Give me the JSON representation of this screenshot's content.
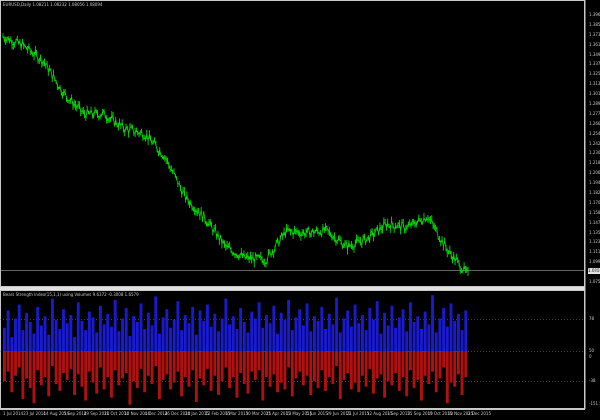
{
  "main_chart": {
    "title": "EURUSD,Daily  1.08211 1.08232 1.08056 1.08094",
    "current_price": "1.08094",
    "y_ticks": [
      "1.39690",
      "1.38500",
      "1.37310",
      "1.36120",
      "1.34930",
      "1.33740",
      "1.32550",
      "1.31360",
      "1.30170",
      "1.28980",
      "1.27790",
      "1.26600",
      "1.25410",
      "1.24220",
      "1.23030",
      "1.21840",
      "1.20650",
      "1.19460",
      "1.18270",
      "1.17080",
      "1.15890",
      "1.14700",
      "1.13510",
      "1.12320",
      "1.11130",
      "1.09940",
      "1.08750",
      "1.07560"
    ]
  },
  "indicator": {
    "title": "Bears Strength Index(15,1,1) using Volumes  9.6372  -0.3008  1.6579",
    "y_ticks": [
      "78",
      "50",
      "0",
      "-38",
      "-151.5"
    ]
  },
  "x_axis": {
    "ticks": [
      "1 Jul 2014",
      "23 Jul 2014",
      "14 Aug 2014",
      "5 Sep 2014",
      "29 Sep 2014",
      "21 Oct 2014",
      "12 Nov 2014",
      "4 Dec 2014",
      "26 Dec 2014",
      "20 Jan 2015",
      "12 Feb 2015",
      "6 Mar 2015",
      "30 Mar 2015",
      "21 Apr 2015",
      "13 May 2015",
      "5 Jun 2015",
      "29 Jun 2015",
      "21 Jul 2015",
      "12 Aug 2015",
      "3 Sep 2015",
      "25 Sep 2015",
      "19 Oct 2015",
      "10 Nov 2015",
      "2 Dec 2015"
    ]
  },
  "chart_data": [
    {
      "type": "line",
      "title": "EURUSD,Daily  1.08211 1.08232 1.08056 1.08094",
      "series": [
        {
          "name": "EURUSD",
          "color": "#00e000",
          "x": [
            "1 Jul 2014",
            "23 Jul 2014",
            "14 Aug 2014",
            "5 Sep 2014",
            "29 Sep 2014",
            "21 Oct 2014",
            "12 Nov 2014",
            "4 Dec 2014",
            "26 Dec 2014",
            "20 Jan 2015",
            "12 Feb 2015",
            "6 Mar 2015",
            "30 Mar 2015",
            "21 Apr 2015",
            "13 May 2015",
            "5 Jun 2015",
            "29 Jun 2015",
            "21 Jul 2015",
            "12 Aug 2015",
            "3 Sep 2015",
            "25 Sep 2015",
            "19 Oct 2015",
            "10 Nov 2015",
            "2 Dec 2015"
          ],
          "values": [
            1.369,
            1.357,
            1.337,
            1.295,
            1.268,
            1.268,
            1.249,
            1.242,
            1.213,
            1.16,
            1.132,
            1.095,
            1.08,
            1.078,
            1.115,
            1.113,
            1.116,
            1.095,
            1.105,
            1.125,
            1.12,
            1.135,
            1.09,
            1.058
          ]
        }
      ],
      "ylim": [
        1.049,
        1.3969
      ],
      "grid": false
    },
    {
      "type": "bar",
      "title": "Bears Strength Index(15,1,1) using Volumes  9.6372  -0.3008  1.6579",
      "series": [
        {
          "name": "positive",
          "color": "#1a1ad0",
          "values": [
            20,
            35,
            12,
            28,
            40,
            18,
            33,
            25,
            15,
            38,
            22,
            30,
            14,
            45,
            27,
            19,
            36,
            24,
            31,
            12,
            42,
            26,
            18,
            34,
            29,
            16,
            39,
            23,
            32,
            21,
            44,
            17,
            28,
            37,
            13,
            30,
            25,
            41,
            19,
            33,
            22,
            47,
            15,
            29,
            36,
            20,
            27,
            43,
            18,
            31,
            24,
            38,
            14,
            35,
            26,
            40,
            21,
            32,
            17,
            28,
            45,
            23,
            30,
            19,
            37,
            25,
            16,
            34,
            28,
            42,
            20,
            31,
            24,
            39,
            15,
            33,
            27,
            44,
            18,
            29,
            36,
            22,
            41,
            17,
            30,
            26,
            38,
            19,
            32,
            23,
            46,
            16,
            28,
            35,
            21,
            40,
            24,
            31,
            18,
            37,
            27,
            43,
            15,
            33,
            22,
            39,
            20,
            29,
            36,
            17,
            42,
            25,
            30,
            19,
            34,
            23,
            48,
            16,
            28,
            37,
            21,
            41,
            26,
            32,
            18,
            35
          ]
        },
        {
          "name": "negative",
          "color": "#b01010",
          "values": [
            -22,
            -15,
            -30,
            -18,
            -12,
            -35,
            -20,
            -27,
            -38,
            -14,
            -25,
            -19,
            -33,
            -11,
            -24,
            -29,
            -16,
            -21,
            -13,
            -32,
            -17,
            -26,
            -36,
            -15,
            -23,
            -31,
            -12,
            -28,
            -19,
            -34,
            -14,
            -25,
            -20,
            -16,
            -39,
            -22,
            -27,
            -13,
            -30,
            -18,
            -24,
            -11,
            -35,
            -21,
            -17,
            -28,
            -23,
            -15,
            -33,
            -19,
            -26,
            -14,
            -37,
            -20,
            -25,
            -13,
            -29,
            -18,
            -32,
            -22,
            -12,
            -27,
            -19,
            -34,
            -16,
            -24,
            -31,
            -15,
            -21,
            -14,
            -36,
            -19,
            -26,
            -17,
            -30,
            -23,
            -28,
            -12,
            -33,
            -20,
            -15,
            -25,
            -18,
            -32,
            -22,
            -27,
            -14,
            -29,
            -19,
            -24,
            -11,
            -35,
            -21,
            -16,
            -28,
            -23,
            -30,
            -18,
            -26,
            -13,
            -31,
            -20,
            -17,
            -34,
            -22,
            -25,
            -16,
            -29,
            -19,
            -33,
            -14,
            -27,
            -21,
            -36,
            -18,
            -24,
            -15,
            -30,
            -20,
            -12,
            -38,
            -23,
            -26,
            -17,
            -32,
            -19
          ]
        }
      ],
      "ylim": [
        -151.5,
        100
      ],
      "grid": true
    }
  ]
}
